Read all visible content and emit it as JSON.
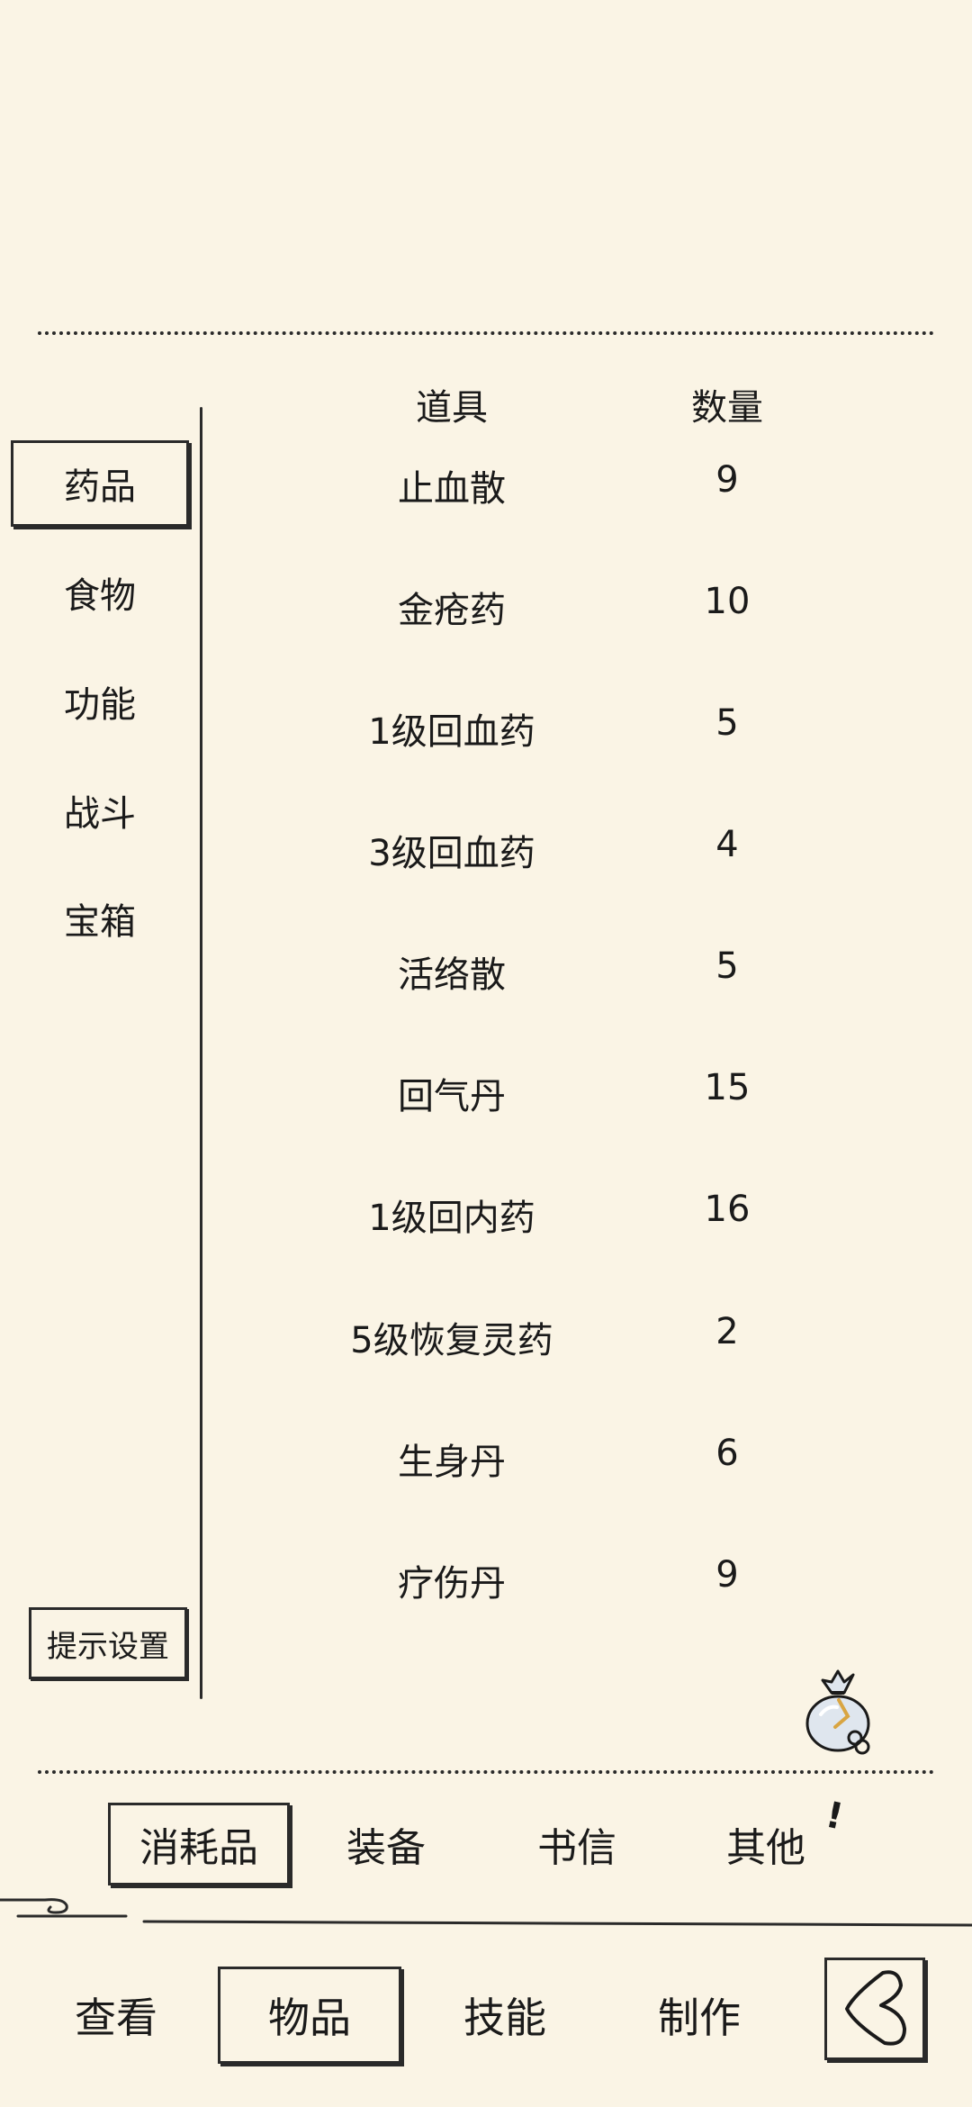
{
  "table": {
    "header_item": "道具",
    "header_quantity": "数量",
    "rows": [
      {
        "name": "止血散",
        "qty": "9"
      },
      {
        "name": "金疮药",
        "qty": "10"
      },
      {
        "name": "1级回血药",
        "qty": "5"
      },
      {
        "name": "3级回血药",
        "qty": "4"
      },
      {
        "name": "活络散",
        "qty": "5"
      },
      {
        "name": "回气丹",
        "qty": "15"
      },
      {
        "name": "1级回内药",
        "qty": "16"
      },
      {
        "name": "5级恢复灵药",
        "qty": "2"
      },
      {
        "name": "生身丹",
        "qty": "6"
      },
      {
        "name": "疗伤丹",
        "qty": "9"
      }
    ]
  },
  "sidebar": {
    "categories": [
      {
        "label": "药品",
        "selected": true
      },
      {
        "label": "食物",
        "selected": false
      },
      {
        "label": "功能",
        "selected": false
      },
      {
        "label": "战斗",
        "selected": false
      },
      {
        "label": "宝箱",
        "selected": false
      }
    ],
    "hint_settings_label": "提示设置"
  },
  "subtabs": [
    {
      "label": "消耗品",
      "selected": true
    },
    {
      "label": "装备",
      "selected": false
    },
    {
      "label": "书信",
      "selected": false
    },
    {
      "label": "其他",
      "selected": false
    }
  ],
  "subtab_alert": "!",
  "nav": [
    {
      "label": "查看",
      "selected": false
    },
    {
      "label": "物品",
      "selected": true
    },
    {
      "label": "技能",
      "selected": false
    },
    {
      "label": "制作",
      "selected": false
    }
  ],
  "icons": {
    "bag": "item-bag-icon",
    "back": "back-arrow-icon"
  },
  "colors": {
    "background": "#faf4e5",
    "ink": "#1a1a1a"
  }
}
